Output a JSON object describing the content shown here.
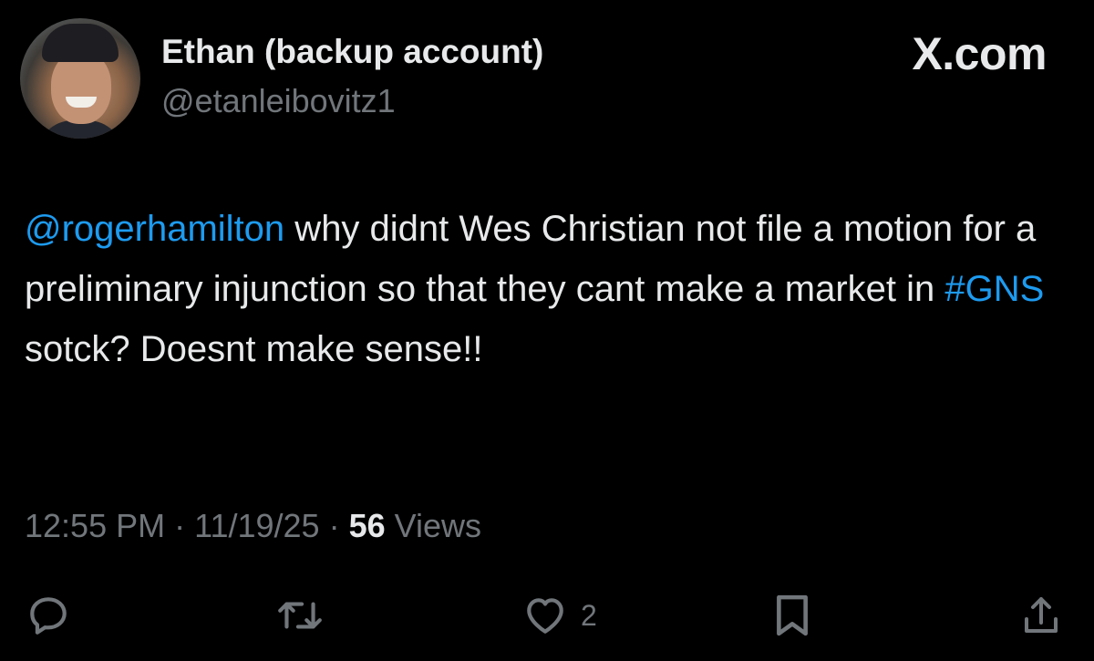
{
  "post": {
    "author": {
      "display_name": "Ethan (backup account)",
      "handle": "@etanleibovitz1"
    },
    "brand": "X.com",
    "text": {
      "mention": "@rogerhamilton",
      "part1": " why didnt Wes Christian not file a motion for a preliminary injunction so that they cant make a market in ",
      "hashtag": "#GNS",
      "part2": " sotck?  Doesnt make sense!!"
    },
    "meta": {
      "time": "12:55 PM",
      "sep1": " · ",
      "date": "11/19/25",
      "sep2": " · ",
      "views_count": "56",
      "views_label": " Views"
    },
    "actions": {
      "like_count": "2"
    }
  },
  "colors": {
    "background": "#000000",
    "text": "#e7e9ea",
    "secondary": "#71767b",
    "link": "#1d9bf0"
  },
  "icons": [
    "reply-icon",
    "repost-icon",
    "like-icon",
    "bookmark-icon",
    "share-icon"
  ]
}
